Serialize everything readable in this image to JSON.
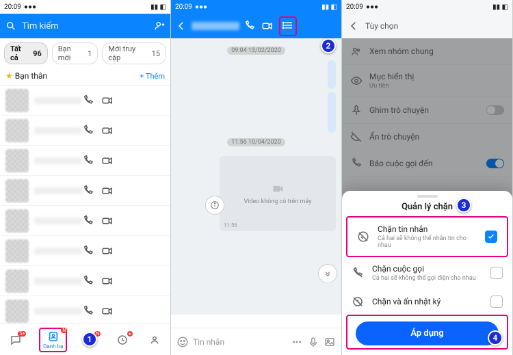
{
  "status_time": "20:09",
  "pane1": {
    "search_placeholder": "Tìm kiếm",
    "tabs": {
      "all": "Tất cả",
      "all_n": "96",
      "new": "Bạn mới",
      "new_n": "1",
      "recent": "Mới truy cập",
      "recent_n": "15"
    },
    "friends_label": "Bạn thân",
    "add": "+ Thêm",
    "bottom": {
      "item2": "Danh bạ",
      "badge5": "5+",
      "badgeN": "N"
    }
  },
  "pane2": {
    "time1": "09:04 13/02/2020",
    "time2": "11:56 10/04/2020",
    "video_missing": "Video không có trên máy",
    "video_time": "11:56",
    "input_placeholder": "Tin nhắn"
  },
  "pane3": {
    "title": "Tùy chọn",
    "rows": {
      "group": "Xem nhóm chung",
      "display": "Mục hiển thị",
      "display_sub": "Ưu tiên",
      "pin": "Ghim trò chuyện",
      "hide": "Ẩn trò chuyện",
      "incoming": "Báo cuộc gọi đến"
    },
    "sheet": {
      "title": "Quản lý chặn",
      "block_msg": "Chặn tin nhắn",
      "block_msg_sub": "Cả hai sẽ không thể nhắn tin cho nhau",
      "block_call": "Chặn cuộc gọi",
      "block_call_sub": "Cả hai sẽ không thể gọi điện cho nhau",
      "block_log": "Chặn và ẩn nhật ký",
      "apply": "Áp dụng"
    }
  },
  "ann": {
    "1": "1",
    "2": "2",
    "3": "3",
    "4": "4"
  }
}
